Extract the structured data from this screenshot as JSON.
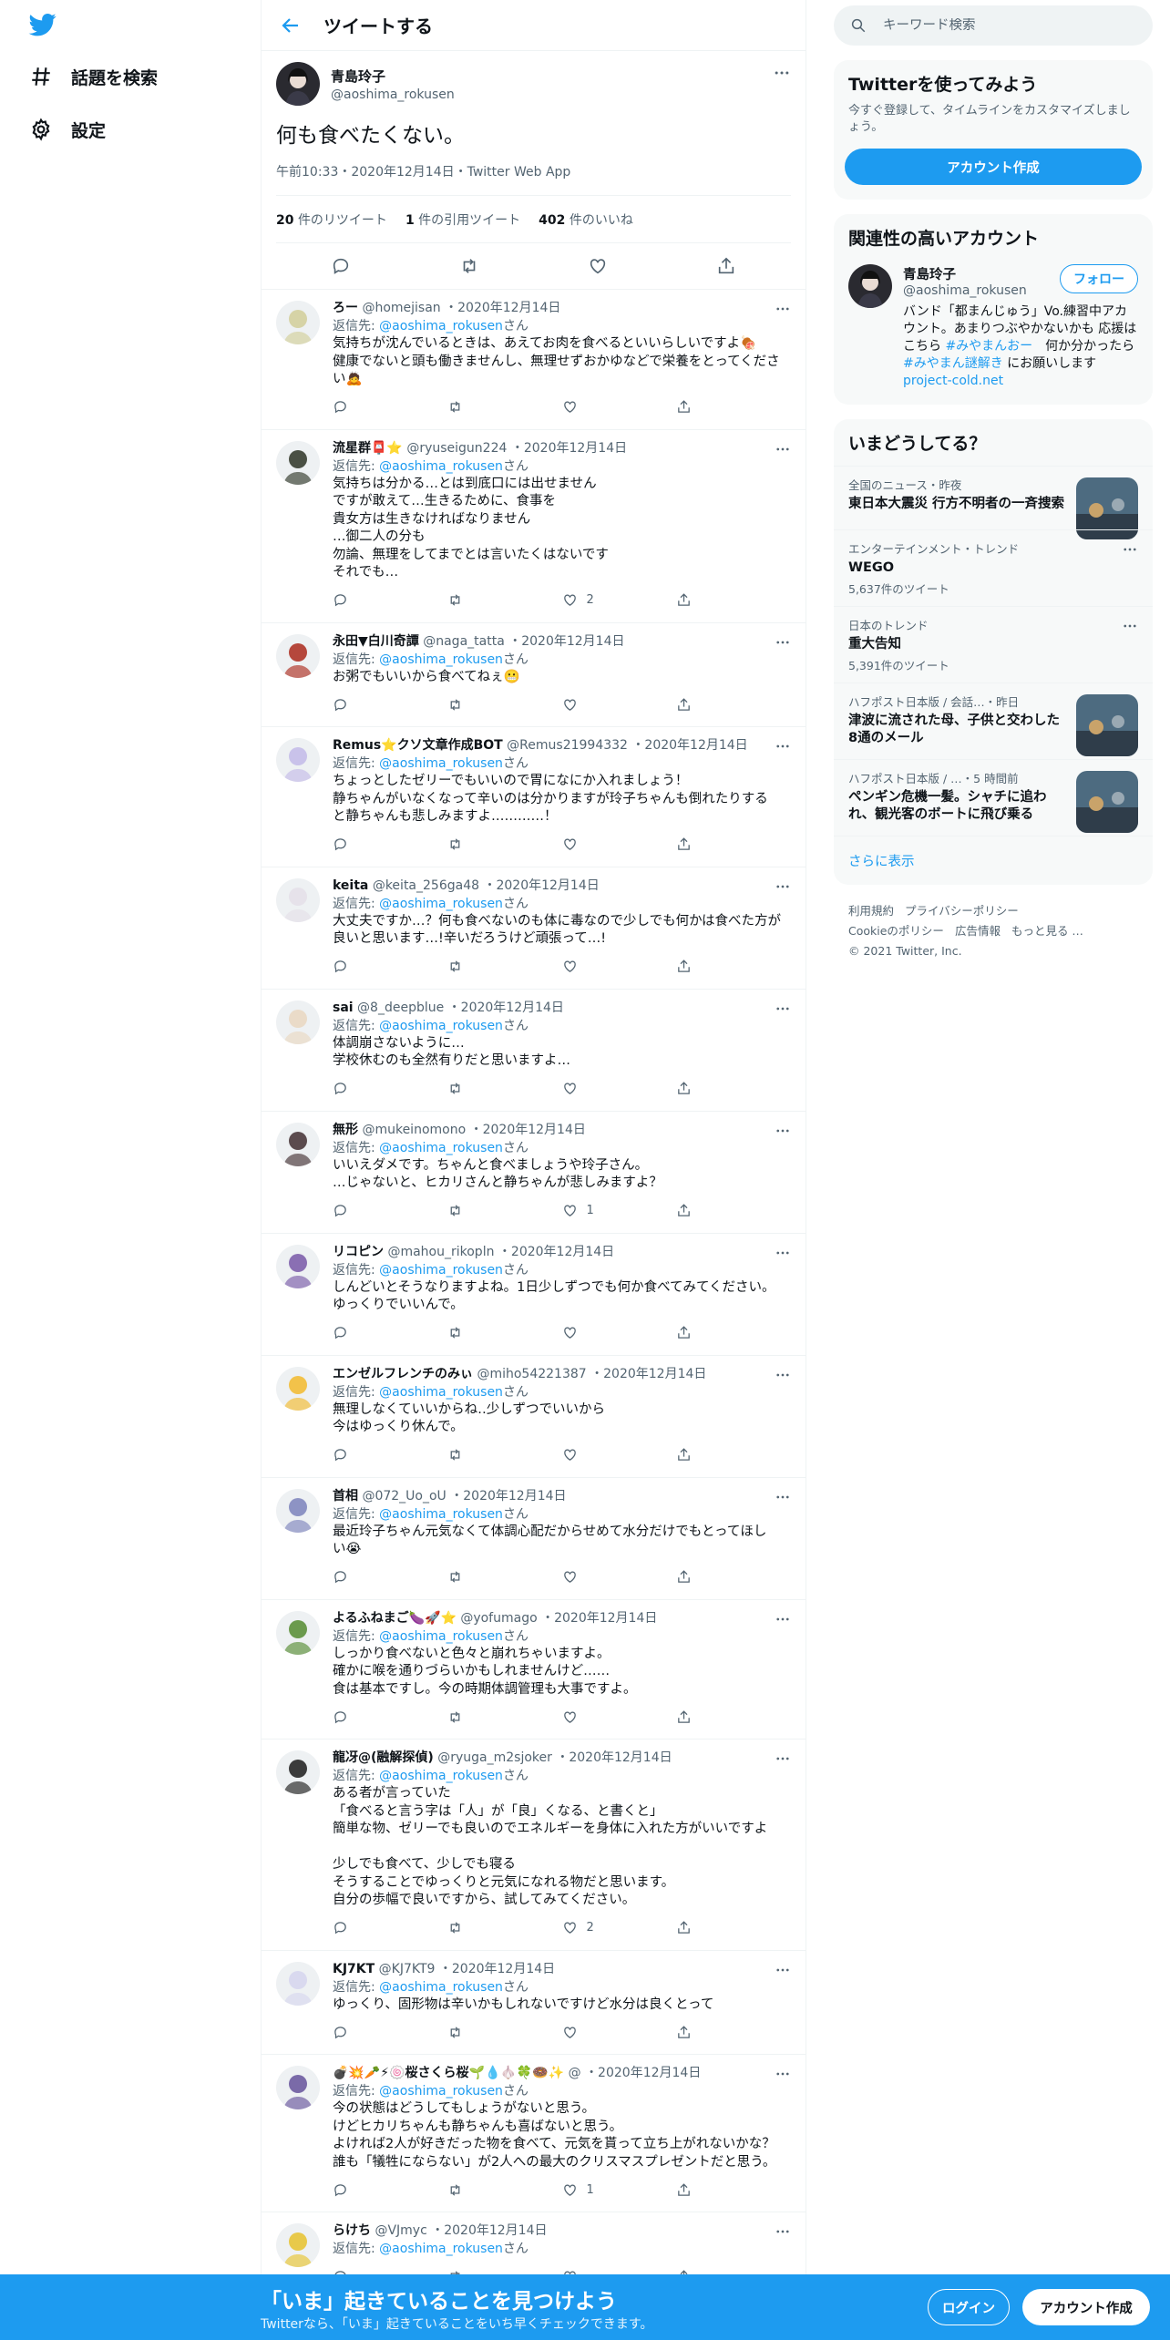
{
  "nav": {
    "explore_label": "話題を検索",
    "settings_label": "設定"
  },
  "header": {
    "title": "ツイートする"
  },
  "tweet": {
    "name": "青島玲子",
    "handle": "@aoshima_rokusen",
    "text": "何も食べたくない。",
    "meta": "午前10:33・2020年12月14日・Twitter Web App",
    "retweets": "20",
    "retweets_label": "件のリツイート",
    "quotes": "1",
    "quotes_label": "件の引用ツイート",
    "likes": "402",
    "likes_label": "件のいいね"
  },
  "reply_to_prefix": "返信先: ",
  "reply_to_handle": "@aoshima_rokusen",
  "reply_to_suffix": "さん",
  "replies": [
    {
      "name": "ろー",
      "handle": "@homejisan",
      "date": "・2020年12月14日",
      "text": "気持ちが沈んでいるときは、あえてお肉を食べるといいらしいですよ🍖\n健康でないと頭も働きませんし、無理せずおかゆなどで栄養をとってくださ\nい🙇",
      "likes": "",
      "avatar": "#d6d3a6"
    },
    {
      "name": "流星群📮⭐",
      "handle": "@ryuseigun224",
      "date": "・2020年12月14日",
      "text": "気持ちは分かる…とは到底口には出せません\nですが敢えて…生きるために、食事を\n貴女方は生きなければなりません\n…御二人の分も\n勿論、無理をしてまでとは言いたくはないです\nそれでも…",
      "likes": "2",
      "avatar": "#4a5044"
    },
    {
      "name": "永田▼白川奇譚",
      "handle": "@naga_tatta",
      "date": "・2020年12月14日",
      "text": "お粥でもいいから食べてねぇ😬",
      "likes": "",
      "avatar": "#b5473c"
    },
    {
      "name": "Remus⭐クソ文章作成BOT",
      "handle": "@Remus21994332",
      "date": "・2020年12月14日",
      "text": "ちょっとしたゼリーでもいいので胃になにか入れましょう！\n静ちゃんがいなくなって辛いのは分かりますが玲子ちゃんも倒れたりする\nと静ちゃんも悲しみますよ…………！",
      "likes": "",
      "avatar": "#c9c2ea"
    },
    {
      "name": "keita",
      "handle": "@keita_256ga48",
      "date": "・2020年12月14日",
      "text": "大丈夫ですか…？何も食べないのも体に毒なので少しでも何かは食べた方が\n良いと思います…!辛いだろうけど頑張って…!",
      "likes": "",
      "avatar": "#e6e2ea"
    },
    {
      "name": "sai",
      "handle": "@8_deepblue",
      "date": "・2020年12月14日",
      "text": "体調崩さないように…\n学校休むのも全然有りだと思いますよ…",
      "likes": "",
      "avatar": "#eadbc8"
    },
    {
      "name": "無形",
      "handle": "@mukeinomono",
      "date": "・2020年12月14日",
      "text": "いいえダメです。ちゃんと食べましょうや玲子さん。\n…じゃないと、ヒカリさんと静ちゃんが悲しみますよ？",
      "likes": "1",
      "avatar": "#5b4b4e"
    },
    {
      "name": "リコピン",
      "handle": "@mahou_rikopln",
      "date": "・2020年12月14日",
      "text": "しんどいとそうなりますよね。1日少しずつでも何か食べてみてください。\nゆっくりでいいんで。",
      "likes": "",
      "avatar": "#8a6fb3"
    },
    {
      "name": "エンゼルフレンチのみぃ",
      "handle": "@miho54221387",
      "date": "・2020年12月14日",
      "text": "無理しなくていいからね‥少しずつでいいから\n今はゆっくり休んで。",
      "likes": "",
      "avatar": "#f2c24a"
    },
    {
      "name": "首相",
      "handle": "@072_Uo_oU",
      "date": "・2020年12月14日",
      "text": "最近玲子ちゃん元気なくて体調心配だからせめて水分だけでもとってほし\nい😭",
      "likes": "",
      "avatar": "#8d93c4"
    },
    {
      "name": "よるふねまご🍆🚀⭐",
      "handle": "@yofumago",
      "date": "・2020年12月14日",
      "text": "しっかり食べないと色々と崩れちゃいますよ。\n確かに喉を通りづらいかもしれませんけど……\n食は基本ですし。今の時期体調管理も大事ですよ。",
      "likes": "",
      "avatar": "#6b9a4d"
    },
    {
      "name": "龍冴@(融解探偵)",
      "handle": "@ryuga_m2sjoker",
      "date": "・2020年12月14日",
      "text": "ある者が言っていた\n「食べると言う字は「人」が「良」くなる、と書くと」\n簡単な物、ゼリーでも良いのでエネルギーを身体に入れた方がいいですよ\n\n少しでも食べて、少しでも寝る\nそうすることでゆっくりと元気になれる物だと思います。\n自分の歩幅で良いですから、試してみてください。",
      "likes": "2",
      "avatar": "#3b3b3b"
    },
    {
      "name": "KJ7KT",
      "handle": "@KJ7KT9",
      "date": "・2020年12月14日",
      "text": "ゆっくり、固形物は辛いかもしれないですけど水分は良くとって",
      "likes": "",
      "avatar": "#d9d9ef"
    },
    {
      "name": "💣💥🥕⚡🍥桜さくら桜🌱💧🧄🍀🍩✨",
      "handle": "@",
      "date": "・2020年12月14日",
      "text": "今の状態はどうしてもしょうがないと思う。\nけどヒカリちゃんも静ちゃんも喜ばないと思う。\nよければ2人が好きだった物を食べて、元気を貰って立ち上がれないかな？\n誰も「犠牲にならない」が2人への最大のクリスマスプレゼントだと思う。",
      "likes": "1",
      "avatar": "#7a6aa8"
    },
    {
      "name": "らけち",
      "handle": "@VJmyc",
      "date": "・2020年12月14日",
      "text": "",
      "likes": "",
      "avatar": "#e8c94a"
    }
  ],
  "search": {
    "placeholder": "キーワード検索"
  },
  "join": {
    "title": "Twitterを使ってみよう",
    "desc": "今すぐ登録して、タイムラインをカスタマイズしましょう。",
    "button": "アカウント作成"
  },
  "related": {
    "title": "関連性の高いアカウント",
    "name": "青島玲子",
    "handle": "@aoshima_rokusen",
    "follow": "フォロー",
    "bio_1": "バンド「都まんじゅう」Vo.練習中アカウント。あまりつぶやかないかも 応援はこちら ",
    "bio_tag_1": "#みやまんおー",
    "bio_2": "　何か分かったら ",
    "bio_tag_2": "#みやまん謎解き",
    "bio_3": " にお願いします　",
    "bio_link": "project-cold.net"
  },
  "trends": {
    "title": "いまどうしてる？",
    "items": [
      {
        "meta": "全国のニュース・昨夜",
        "title": "東日本大震災 行方不明者の一斉捜索",
        "count": "",
        "image": "news-photo"
      },
      {
        "meta": "エンターテインメント・トレンド",
        "title": "WEGO",
        "count": "5,637件のツイート",
        "image": ""
      },
      {
        "meta": "日本のトレンド",
        "title": "重大告知",
        "count": "5,391件のツイート",
        "image": ""
      },
      {
        "meta": "ハフポスト日本版 / 会話…・昨日",
        "title": "津波に流された母、子供と交わした8通のメール",
        "count": "",
        "image": "news-photo"
      },
      {
        "meta": "ハフポスト日本版 / …・5 時間前",
        "title": "ペンギン危機一髪。シャチに追われ、観光客のボートに飛び乗る",
        "count": "",
        "image": "news-photo"
      }
    ],
    "show_more": "さらに表示"
  },
  "footer": {
    "terms": "利用規約",
    "privacy": "プライバシーポリシー",
    "cookie": "Cookieのポリシー",
    "ads": "広告情報",
    "more": "もっと見る …",
    "copyright": "© 2021 Twitter, Inc."
  },
  "bottom_bar": {
    "title": "「いま」起きていることを見つけよう",
    "subtitle": "Twitterなら、「いま」起きていることをいち早くチェックできます。",
    "login": "ログイン",
    "signup": "アカウント作成"
  },
  "colors": {
    "accent": "#1d9bf0",
    "text": "#0f1419",
    "muted": "#536471",
    "border": "#eff3f4"
  }
}
